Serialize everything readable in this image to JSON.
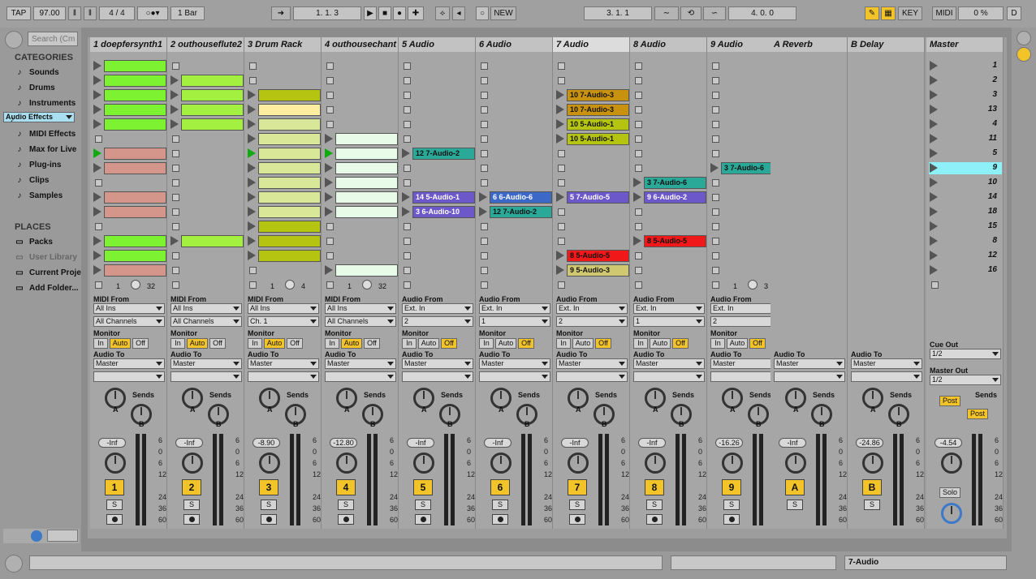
{
  "transport": {
    "tap": "TAP",
    "tempo": "97.00",
    "signature": "4 / 4",
    "quant": "1 Bar",
    "position": "1.   1.   3",
    "new": "NEW",
    "loop_start": "3.   1.   1",
    "loop_len": "4.   0.   0",
    "key": "KEY",
    "midi": "MIDI",
    "cpu": "0 %",
    "d": "D"
  },
  "browser": {
    "search_placeholder": "Search (Cm",
    "categories_title": "CATEGORIES",
    "categories": [
      {
        "label": "Sounds",
        "icon": "note-icon"
      },
      {
        "label": "Drums",
        "icon": "drums-icon"
      },
      {
        "label": "Instruments",
        "icon": "instrument-icon"
      },
      {
        "label": "Audio Effects",
        "icon": "audio-fx-icon"
      },
      {
        "label": "MIDI Effects",
        "icon": "midi-fx-icon"
      },
      {
        "label": "Max for Live",
        "icon": "max-icon"
      },
      {
        "label": "Plug-ins",
        "icon": "plugin-icon"
      },
      {
        "label": "Clips",
        "icon": "clip-icon"
      },
      {
        "label": "Samples",
        "icon": "sample-icon"
      }
    ],
    "places_title": "PLACES",
    "places": [
      {
        "label": "Packs"
      },
      {
        "label": "User Library"
      },
      {
        "label": "Current Proje"
      },
      {
        "label": "Add Folder..."
      }
    ]
  },
  "tracks": [
    {
      "name": "1 doepfersynth1",
      "type": "midi",
      "from": "All Ins",
      "chan": "All Channels",
      "monitor": "Auto",
      "vol": "-Inf",
      "num": "1",
      "ctrl": [
        "1",
        "32"
      ]
    },
    {
      "name": "2 outhouseflute2",
      "type": "midi",
      "from": "All Ins",
      "chan": "All Channels",
      "monitor": "Auto",
      "vol": "-Inf",
      "num": "2",
      "ctrl": []
    },
    {
      "name": "3 Drum Rack",
      "type": "midi",
      "from": "All Ins",
      "chan": "Ch. 1",
      "monitor": "Auto",
      "vol": "-8.90",
      "num": "3",
      "ctrl": [
        "1",
        "4"
      ]
    },
    {
      "name": "4 outhousechant",
      "type": "midi",
      "from": "All Ins",
      "chan": "All Channels",
      "monitor": "Auto",
      "vol": "-12.80",
      "num": "4",
      "ctrl": [
        "1",
        "32"
      ]
    },
    {
      "name": "5 Audio",
      "type": "audio",
      "from": "Ext. In",
      "chan": "2",
      "monitor": "Off",
      "vol": "-Inf",
      "num": "5",
      "ctrl": []
    },
    {
      "name": "6 Audio",
      "type": "audio",
      "from": "Ext. In",
      "chan": "1",
      "monitor": "Off",
      "vol": "-Inf",
      "num": "6",
      "ctrl": []
    },
    {
      "name": "7 Audio",
      "type": "audio",
      "from": "Ext. In",
      "chan": "2",
      "monitor": "Off",
      "vol": "-Inf",
      "num": "7",
      "ctrl": []
    },
    {
      "name": "8 Audio",
      "type": "audio",
      "from": "Ext. In",
      "chan": "1",
      "monitor": "Off",
      "vol": "-Inf",
      "num": "8",
      "ctrl": []
    },
    {
      "name": "9 Audio",
      "type": "audio",
      "from": "Ext. In",
      "chan": "2",
      "monitor": "Off",
      "vol": "-16.26",
      "num": "9",
      "ctrl": [
        "1",
        "3"
      ]
    },
    {
      "name": "A Reverb",
      "type": "return",
      "vol": "-Inf",
      "num": "A"
    },
    {
      "name": "B Delay",
      "type": "return",
      "vol": "-24.86",
      "num": "B"
    }
  ],
  "labels": {
    "midi_from": "MIDI From",
    "audio_from": "Audio From",
    "monitor": "Monitor",
    "in": "In",
    "auto": "Auto",
    "off": "Off",
    "audio_to": "Audio To",
    "master": "Master",
    "sends": "Sends",
    "a": "A",
    "b": "B",
    "s": "S",
    "cue_out": "Cue Out",
    "master_out": "Master Out",
    "half": "1/2",
    "post": "Post",
    "solo": "Solo",
    "scale": [
      "6",
      "0",
      "6",
      "12",
      "24",
      "36",
      "60"
    ]
  },
  "master": {
    "name": "Master",
    "vol": "-4.54",
    "scenes": [
      "1",
      "2",
      "3",
      "13",
      "4",
      "11",
      "5",
      "9",
      "10",
      "14",
      "18",
      "15",
      "8",
      "12",
      "16"
    ]
  },
  "clips": {
    "0": [
      [
        "#7cf230",
        ""
      ],
      [
        "#7cf230",
        ""
      ],
      [
        "#7cf230",
        ""
      ],
      [
        "#7cf230",
        ""
      ],
      [
        "#7cf230",
        ""
      ],
      null,
      [
        "#d4968a",
        ""
      ],
      [
        "#d4968a",
        ""
      ],
      null,
      [
        "#d4968a",
        ""
      ],
      [
        "#d4968a",
        ""
      ],
      null,
      [
        "#7cf230",
        ""
      ],
      [
        "#7cf230",
        ""
      ],
      [
        "#d4968a",
        ""
      ]
    ],
    "1": [
      null,
      [
        "#a4f040",
        ""
      ],
      [
        "#a4f040",
        ""
      ],
      [
        "#a4f040",
        ""
      ],
      [
        "#a4f040",
        ""
      ],
      null,
      null,
      null,
      null,
      null,
      null,
      null,
      [
        "#a4f040",
        ""
      ],
      null,
      null
    ],
    "2": [
      null,
      null,
      [
        "#b4c410",
        ""
      ],
      [
        "#ffeea0",
        ""
      ],
      [
        "#d8e898",
        ""
      ],
      [
        "#d8e898",
        ""
      ],
      [
        "#d8e898",
        ""
      ],
      [
        "#d8e898",
        ""
      ],
      [
        "#d8e898",
        ""
      ],
      [
        "#d8e898",
        ""
      ],
      [
        "#d8e898",
        ""
      ],
      [
        "#b4c410",
        ""
      ],
      [
        "#b4c410",
        ""
      ],
      [
        "#b4c410",
        ""
      ],
      null
    ],
    "3": [
      null,
      null,
      null,
      null,
      null,
      [
        "#e8fae8",
        ""
      ],
      [
        "#e8fae8",
        ""
      ],
      [
        "#e8fae8",
        ""
      ],
      [
        "#e8fae8",
        ""
      ],
      [
        "#e8fae8",
        ""
      ],
      [
        "#e8fae8",
        ""
      ],
      null,
      null,
      null,
      [
        "#e8fae8",
        ""
      ]
    ],
    "4": [
      null,
      null,
      null,
      null,
      null,
      null,
      [
        "#2aa898",
        "12 7-Audio-2"
      ],
      null,
      null,
      [
        "#6c58c8",
        "14 5-Audio-1"
      ],
      [
        "#6c58c8",
        "3 6-Audio-10"
      ],
      null,
      null,
      null,
      null
    ],
    "5": [
      null,
      null,
      null,
      null,
      null,
      null,
      null,
      null,
      null,
      [
        "#3c68c8",
        "6 6-Audio-6"
      ],
      [
        "#2aa898",
        "12 7-Audio-2"
      ],
      null,
      null,
      null,
      null
    ],
    "6": [
      null,
      null,
      [
        "#c8920e",
        "10 7-Audio-3"
      ],
      [
        "#c8920e",
        "10 7-Audio-3"
      ],
      [
        "#b4c410",
        "10 5-Audio-1"
      ],
      [
        "#b4c410",
        "10 5-Audio-1"
      ],
      null,
      null,
      null,
      [
        "#6c58c8",
        "5 7-Audio-5"
      ],
      null,
      null,
      null,
      [
        "#f01818",
        "8 5-Audio-5"
      ],
      [
        "#d0c870",
        "9 5-Audio-3"
      ]
    ],
    "7": [
      null,
      null,
      null,
      null,
      null,
      null,
      null,
      null,
      [
        "#2aa898",
        "3 7-Audio-6"
      ],
      [
        "#6c58c8",
        "9 6-Audio-2"
      ],
      null,
      null,
      [
        "#f01818",
        "8 5-Audio-5"
      ],
      null,
      null
    ],
    "8": [
      null,
      null,
      null,
      null,
      null,
      null,
      null,
      [
        "#2aa898",
        "3 7-Audio-6"
      ],
      null,
      null,
      null,
      null,
      null,
      null,
      null
    ]
  },
  "status": {
    "track": "7-Audio"
  }
}
